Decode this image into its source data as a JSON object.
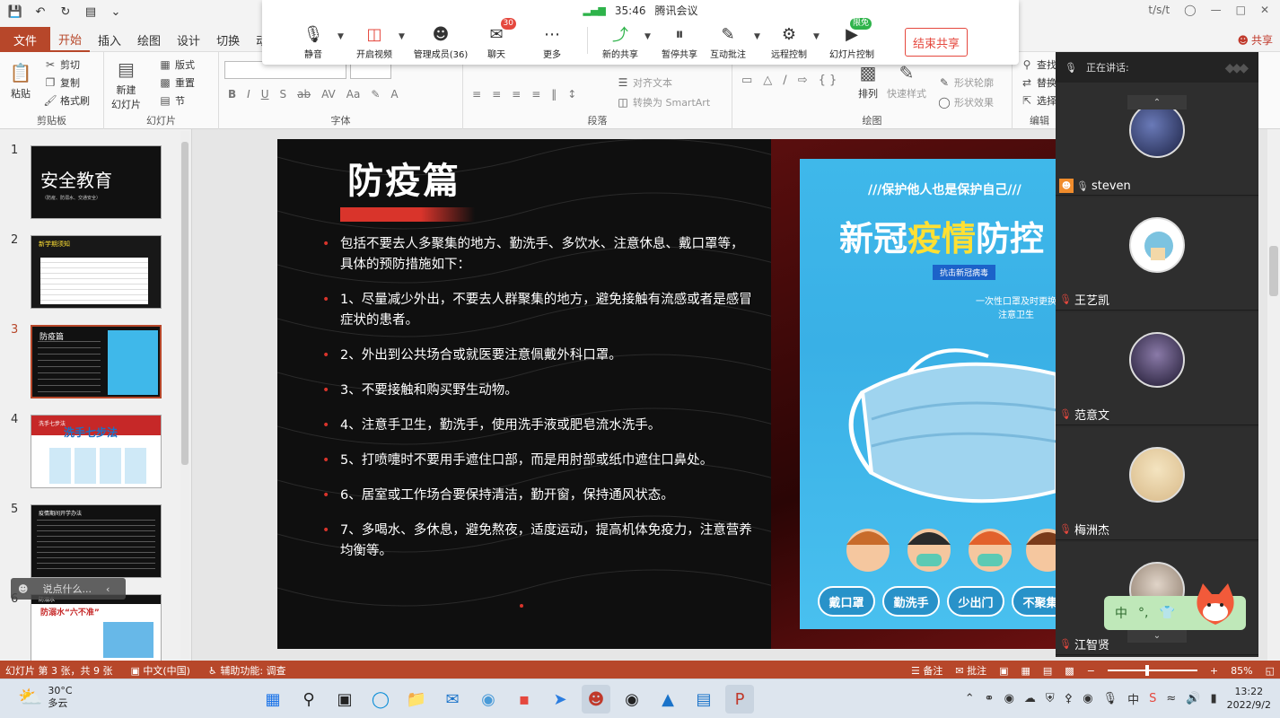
{
  "titlebar": {
    "user_initials": "t/s/t"
  },
  "tabs": {
    "file": "文件",
    "items": [
      "开始",
      "插入",
      "绘图",
      "设计",
      "切换",
      "动画"
    ],
    "active": "开始",
    "share": "共享"
  },
  "ribbon": {
    "clipboard": {
      "label": "剪贴板",
      "paste": "粘贴",
      "cut": "剪切",
      "copy": "复制",
      "format_painter": "格式刷"
    },
    "slides": {
      "label": "幻灯片",
      "new_slide": "新建\n幻灯片",
      "layout": "版式",
      "reset": "重置",
      "section": "节"
    },
    "font": {
      "label": "字体"
    },
    "paragraph": {
      "label": "段落",
      "align_text": "对齐文本",
      "smartart": "转换为 SmartArt"
    },
    "drawing": {
      "label": "绘图",
      "arrange": "排列",
      "quick_styles": "快速样式",
      "shape_outline": "形状轮廓",
      "shape_effects": "形状效果"
    },
    "editing": {
      "label": "编辑",
      "find": "查找",
      "replace": "替换",
      "select": "选择"
    }
  },
  "meeting": {
    "timer": "35:46",
    "app_name": "腾讯会议",
    "tools": [
      {
        "id": "mute",
        "label": "静音",
        "icon": "microphone-icon"
      },
      {
        "id": "video",
        "label": "开启视频",
        "icon": "video-off-icon"
      },
      {
        "id": "members",
        "label": "管理成员(36)",
        "icon": "person-icon"
      },
      {
        "id": "chat",
        "label": "聊天",
        "icon": "chat-icon",
        "badge": "30"
      },
      {
        "id": "more",
        "label": "更多",
        "icon": "more-icon"
      },
      {
        "id": "new_share",
        "label": "新的共享",
        "icon": "share-icon"
      },
      {
        "id": "pause_share",
        "label": "暂停共享",
        "icon": "pause-icon"
      },
      {
        "id": "annotate",
        "label": "互动批注",
        "icon": "annotate-icon"
      },
      {
        "id": "remote",
        "label": "远程控制",
        "icon": "remote-icon"
      },
      {
        "id": "slide_ctrl",
        "label": "幻灯片控制",
        "icon": "slideshow-icon",
        "badge": "限免"
      }
    ],
    "end_share": "结束共享"
  },
  "slides": [
    {
      "num": "1",
      "title": "安全教育",
      "subtitle": "（防疫、防溺水、交通安全）"
    },
    {
      "num": "2",
      "title": "新学期须知"
    },
    {
      "num": "3",
      "title": "防疫篇",
      "active": true
    },
    {
      "num": "4",
      "title": "洗手七步法",
      "heading": "洗手七步法"
    },
    {
      "num": "5",
      "title": "疫情期间开学办法"
    },
    {
      "num": "6",
      "title": "防溺水",
      "heading": "防溺水“六不准”"
    }
  ],
  "chat_input": {
    "placeholder": "说点什么..."
  },
  "slide": {
    "title": "防疫篇",
    "bullets": [
      "包括不要去人多聚集的地方、勤洗手、多饮水、注意休息、戴口罩等，具体的预防措施如下：",
      "1、尽量减少外出，不要去人群聚集的地方，避免接触有流感或者是感冒症状的患者。",
      "2、外出到公共场合或就医要注意佩戴外科口罩。",
      "3、不要接触和购买野生动物。",
      "4、注意手卫生，勤洗手，使用洗手液或肥皂流水洗手。",
      "5、打喷嚏时不要用手遮住口部，而是用肘部或纸巾遮住口鼻处。",
      "6、居室或工作场合要保持清洁，勤开窗，保持通风状态。",
      "7、多喝水、多休息，避免熬夜，适度运动，提高机体免疫力，注意营养均衡等。"
    ],
    "poster": {
      "slogan": "///保护他人也是保护自己///",
      "heading_a": "新冠",
      "heading_b": "疫情",
      "heading_c": "防控",
      "badge": "抗击新冠病毒",
      "note": "一次性口罩及时更换\n注意卫生",
      "buttons": [
        "戴口罩",
        "勤洗手",
        "少出门",
        "不聚集"
      ]
    }
  },
  "participants": {
    "speaking_label": "正在讲话:",
    "people": [
      {
        "name": "steven",
        "muted": false
      },
      {
        "name": "王艺凯",
        "muted": true
      },
      {
        "name": "范意文",
        "muted": true
      },
      {
        "name": "梅洲杰",
        "muted": true
      },
      {
        "name": "江智贤",
        "muted": true
      }
    ]
  },
  "ime": {
    "mode": "中",
    "punct": "°,"
  },
  "statusbar": {
    "slide_info": "幻灯片 第 3 张，共 9 张",
    "language": "中文(中国)",
    "accessibility": "辅助功能: 调查",
    "notes": "备注",
    "comments": "批注",
    "zoom": "85%"
  },
  "taskbar": {
    "temperature": "30°C",
    "weather": "多云",
    "ime": "中",
    "time": "13:22",
    "date": "2022/9/2"
  }
}
